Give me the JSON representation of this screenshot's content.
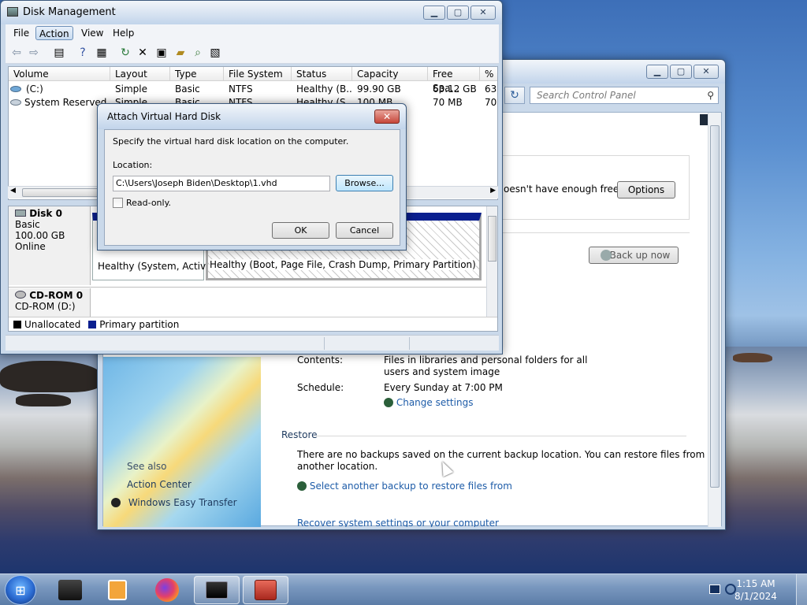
{
  "disk_management": {
    "title": "Disk Management",
    "menu": [
      "File",
      "Action",
      "View",
      "Help"
    ],
    "columns": [
      "Volume",
      "Layout",
      "Type",
      "File System",
      "Status",
      "Capacity",
      "Free Spa...",
      "% F"
    ],
    "rows": [
      {
        "volume": "(C:)",
        "layout": "Simple",
        "type": "Basic",
        "fs": "NTFS",
        "status": "Healthy (B...",
        "capacity": "99.90 GB",
        "free": "63.12 GB",
        "pct": "63"
      },
      {
        "volume": "System Reserved",
        "layout": "Simple",
        "type": "Basic",
        "fs": "NTFS",
        "status": "Healthy (S...",
        "capacity": "100 MB",
        "free": "70 MB",
        "pct": "70"
      }
    ],
    "disk0": {
      "name": "Disk 0",
      "type": "Basic",
      "size": "100.00 GB",
      "state": "Online",
      "part1_status": "Healthy (System, Active,",
      "part2_status": "Healthy (Boot, Page File, Crash Dump, Primary Partition)"
    },
    "cdrom": {
      "name": "CD-ROM 0",
      "drive": "CD-ROM (D:)"
    },
    "legend": {
      "unallocated": "Unallocated",
      "primary": "Primary partition"
    }
  },
  "dialog": {
    "title": "Attach Virtual Hard Disk",
    "instruction": "Specify the virtual hard disk location on the computer.",
    "location_label": "Location:",
    "location_value": "C:\\Users\\Joseph Biden\\Desktop\\1.vhd",
    "browse": "Browse...",
    "readonly": "Read-only.",
    "ok": "OK",
    "cancel": "Cancel"
  },
  "control_panel": {
    "search_placeholder": "Search Control Panel",
    "space_warning": "oesn't have enough free",
    "options": "Options",
    "backup_now": "Back up now",
    "contents_label": "Contents:",
    "contents_value_1": "Files in libraries and personal folders for all",
    "contents_value_2": "users and system image",
    "schedule_label": "Schedule:",
    "schedule_value": "Every Sunday at 7:00 PM",
    "change_settings": "Change settings",
    "restore_heading": "Restore",
    "restore_text_1": "There are no backups saved on the current backup location. You can restore files from",
    "restore_text_2": "another location.",
    "select_backup": "Select another backup to restore files from",
    "recover": "Recover system settings or your computer",
    "see_also": "See also",
    "action_center": "Action Center",
    "easy_transfer": "Windows Easy Transfer"
  },
  "taskbar": {
    "time": "1:15 AM",
    "date": "8/1/2024"
  }
}
